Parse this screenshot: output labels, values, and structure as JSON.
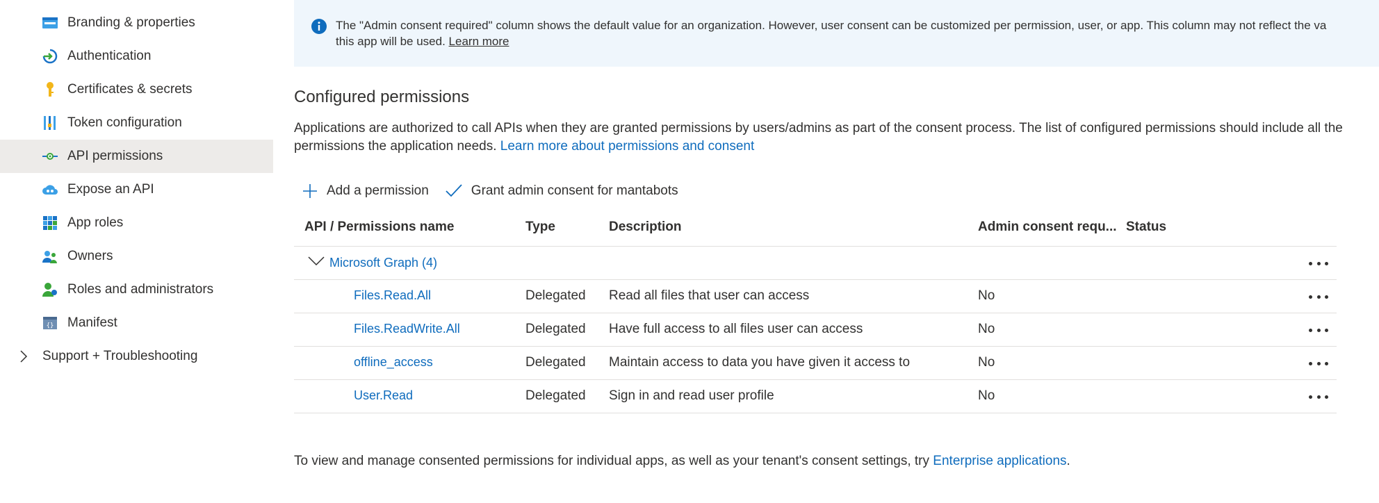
{
  "sidebar": {
    "items": [
      {
        "label": "Branding & properties",
        "icon": "branding-icon"
      },
      {
        "label": "Authentication",
        "icon": "authentication-icon"
      },
      {
        "label": "Certificates & secrets",
        "icon": "key-icon"
      },
      {
        "label": "Token configuration",
        "icon": "token-icon"
      },
      {
        "label": "API permissions",
        "icon": "api-permissions-icon",
        "active": true
      },
      {
        "label": "Expose an API",
        "icon": "cloud-icon"
      },
      {
        "label": "App roles",
        "icon": "app-roles-icon"
      },
      {
        "label": "Owners",
        "icon": "owners-icon"
      },
      {
        "label": "Roles and administrators",
        "icon": "roles-icon"
      },
      {
        "label": "Manifest",
        "icon": "manifest-icon"
      }
    ],
    "group": {
      "label": "Support + Troubleshooting",
      "icon": "chevron-right-icon"
    }
  },
  "info_bar": {
    "line1": "The \"Admin consent required\" column shows the default value for an organization. However, user consent can be customized per permission, user, or app. This column may not reflect the va",
    "line2_prefix": "this app will be used. ",
    "learn_more": "Learn more"
  },
  "configured": {
    "title": "Configured permissions",
    "desc": "Applications are authorized to call APIs when they are granted permissions by users/admins as part of the consent process. The list of configured permissions should include all the permissions the application needs. ",
    "desc_link": "Learn more about permissions and consent"
  },
  "toolbar": {
    "add_label": "Add a permission",
    "grant_label": "Grant admin consent for mantabots"
  },
  "table": {
    "headers": {
      "name": "API / Permissions name",
      "type": "Type",
      "description": "Description",
      "admin": "Admin consent requ...",
      "status": "Status"
    },
    "group_label": "Microsoft Graph (4)",
    "rows": [
      {
        "name": "Files.Read.All",
        "type": "Delegated",
        "description": "Read all files that user can access",
        "admin": "No",
        "status": ""
      },
      {
        "name": "Files.ReadWrite.All",
        "type": "Delegated",
        "description": "Have full access to all files user can access",
        "admin": "No",
        "status": ""
      },
      {
        "name": "offline_access",
        "type": "Delegated",
        "description": "Maintain access to data you have given it access to",
        "admin": "No",
        "status": ""
      },
      {
        "name": "User.Read",
        "type": "Delegated",
        "description": "Sign in and read user profile",
        "admin": "No",
        "status": ""
      }
    ]
  },
  "footer": {
    "text": "To view and manage consented permissions for individual apps, as well as your tenant's consent settings, try ",
    "link": "Enterprise applications",
    "suffix": "."
  },
  "colors": {
    "link": "#0f6cbd",
    "active_bg": "#edebe9",
    "info_bg": "#eff6fc"
  }
}
